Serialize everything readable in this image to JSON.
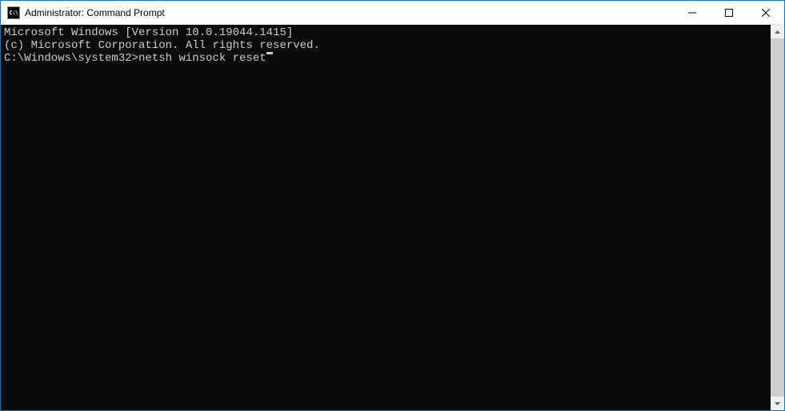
{
  "titlebar": {
    "icon_label": "C:\\",
    "title": "Administrator: Command Prompt"
  },
  "terminal": {
    "line1": "Microsoft Windows [Version 10.0.19044.1415]",
    "line2": "(c) Microsoft Corporation. All rights reserved.",
    "blank": "",
    "prompt": "C:\\Windows\\system32>",
    "command": "netsh winsock reset"
  }
}
